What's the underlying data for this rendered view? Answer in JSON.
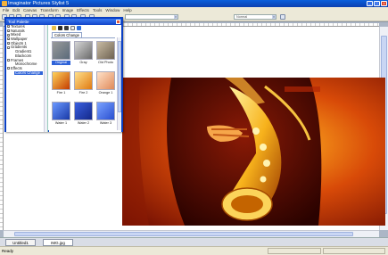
{
  "app": {
    "title": "Imaginator Pictures Stylist 5"
  },
  "menubar": {
    "items": [
      "File",
      "Edit",
      "Canvas",
      "Transform",
      "Image",
      "Effects",
      "Tools",
      "Window",
      "Help"
    ]
  },
  "toolbar": {
    "zoom_value": "",
    "blend_mode": "Normal"
  },
  "palette": {
    "title": "Tool Palette",
    "tree": [
      {
        "label": "Textures",
        "type": "parent"
      },
      {
        "label": "Naturals",
        "type": "parent"
      },
      {
        "label": "Mixed",
        "type": "parent"
      },
      {
        "label": "Wallpaper",
        "type": "parent"
      },
      {
        "label": "Objects 1",
        "type": "parent"
      },
      {
        "label": "Gradients",
        "type": "parent"
      },
      {
        "label": "Gradient1",
        "type": "child"
      },
      {
        "label": "Blackcorn",
        "type": "child"
      },
      {
        "label": "Frames",
        "type": "parent"
      },
      {
        "label": "Monochrome",
        "type": "child"
      },
      {
        "label": "Effects",
        "type": "parent"
      },
      {
        "label": "Colors Change",
        "type": "selected"
      }
    ],
    "tab_label": "Colors Change",
    "thumbnails": [
      {
        "label": "Original",
        "color": "#8a8a8a",
        "selected": true
      },
      {
        "label": "Gray",
        "color": "#9a9a9a",
        "selected": false
      },
      {
        "label": "Old Photo",
        "color": "#a89b84",
        "selected": false
      },
      {
        "label": "Fire 1",
        "color": "#e07a12",
        "selected": false
      },
      {
        "label": "Fire 2",
        "color": "#f3a23a",
        "selected": false
      },
      {
        "label": "Orange 1",
        "color": "#f7b890",
        "selected": false
      },
      {
        "label": "Water 1",
        "color": "#3a66e6",
        "selected": false
      },
      {
        "label": "Water 2",
        "color": "#2e4fc9",
        "selected": false
      },
      {
        "label": "Water 3",
        "color": "#4c7bf0",
        "selected": false
      }
    ]
  },
  "documents": {
    "tabs": [
      "Untitled1",
      "IMG.jpg"
    ],
    "active_index": 1
  },
  "status": {
    "text": "Ready"
  },
  "colors": {
    "title_bar": "#0b3fb0",
    "palette_border": "#0a3fc3",
    "selection": "#2f63d8"
  }
}
